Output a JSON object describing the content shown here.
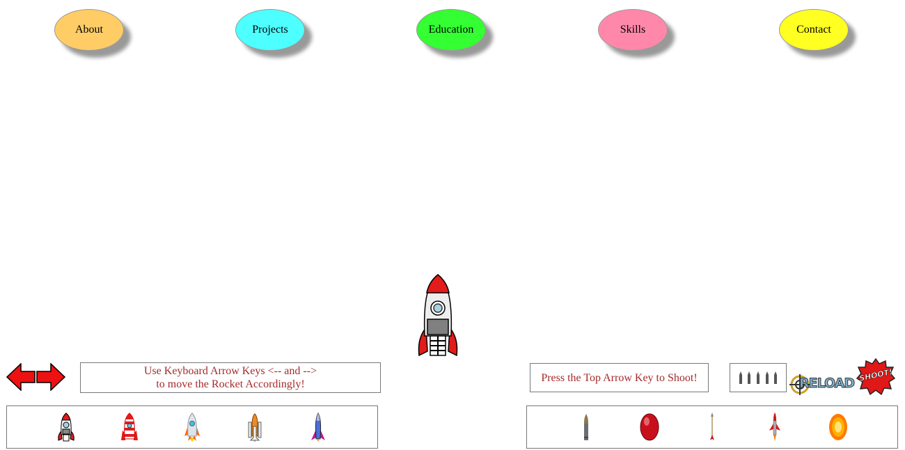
{
  "nav": {
    "items": [
      {
        "label": "About",
        "color": "#ffcc66"
      },
      {
        "label": "Projects",
        "color": "#4dffff"
      },
      {
        "label": "Education",
        "color": "#33ff33"
      },
      {
        "label": "Skills",
        "color": "#ff88aa"
      },
      {
        "label": "Contact",
        "color": "#ffff22"
      }
    ]
  },
  "controls": {
    "move_hint_line1": "Use Keyboard Arrow Keys <-- and -->",
    "move_hint_line2": "to move the Rocket Accordingly!",
    "shoot_hint": "Press the Top Arrow Key to Shoot!",
    "reload_label": "RELOAD",
    "shoot_label": "SHOOT!"
  },
  "rocket_tray": [
    "classic-rocket",
    "striped-rocket",
    "silver-rocket",
    "space-shuttle",
    "purple-rocket"
  ],
  "ammo_tray": [
    "bullet",
    "red-egg",
    "arrow",
    "missile",
    "fireball"
  ],
  "ammo_count": 5
}
